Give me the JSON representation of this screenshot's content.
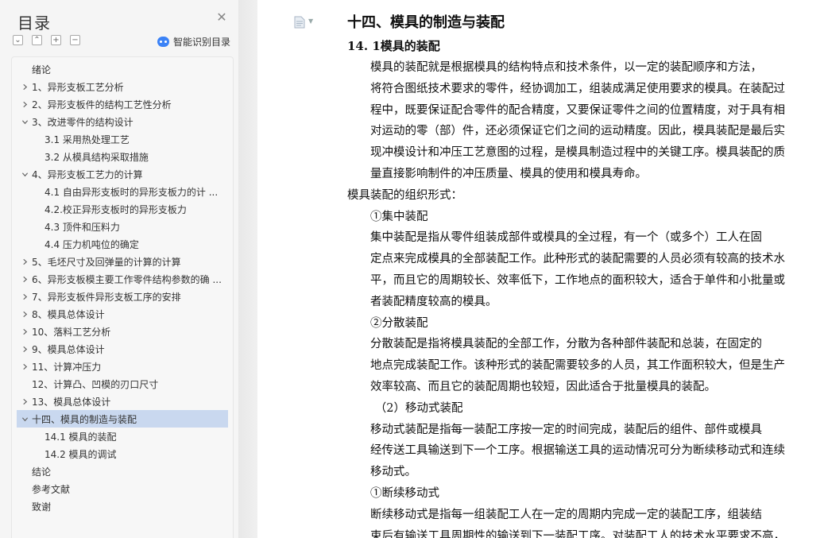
{
  "toc": {
    "title": "目录",
    "smart_label": "智能识别目录",
    "items": [
      {
        "label": "绪论",
        "level": 1,
        "expand": "none"
      },
      {
        "label": "1、异形支板工艺分析",
        "level": 1,
        "expand": "collapsed"
      },
      {
        "label": "2、异形支板件的结构工艺性分析",
        "level": 1,
        "expand": "collapsed"
      },
      {
        "label": "3、改进零件的结构设计",
        "level": 1,
        "expand": "expanded"
      },
      {
        "label": "3.1 采用热处理工艺",
        "level": 2,
        "expand": "none"
      },
      {
        "label": "3.2 从模具结构采取措施",
        "level": 2,
        "expand": "none"
      },
      {
        "label": "4、异形支板工艺力的计算",
        "level": 1,
        "expand": "expanded"
      },
      {
        "label": "4.1 自由异形支板时的异形支板力的计 ...",
        "level": 2,
        "expand": "none"
      },
      {
        "label": "4.2.校正异形支板时的异形支板力",
        "level": 2,
        "expand": "none"
      },
      {
        "label": "4.3 顶件和压料力",
        "level": 2,
        "expand": "none"
      },
      {
        "label": "4.4 压力机吨位的确定",
        "level": 2,
        "expand": "none"
      },
      {
        "label": "5、毛坯尺寸及回弹量的计算的计算",
        "level": 1,
        "expand": "collapsed"
      },
      {
        "label": "6、异形支板模主要工作零件结构参数的确 ...",
        "level": 1,
        "expand": "collapsed"
      },
      {
        "label": "7、异形支板件异形支板工序的安排",
        "level": 1,
        "expand": "collapsed"
      },
      {
        "label": "8、模具总体设计",
        "level": 1,
        "expand": "collapsed"
      },
      {
        "label": "10、落料工艺分析",
        "level": 1,
        "expand": "collapsed"
      },
      {
        "label": "9、模具总体设计",
        "level": 1,
        "expand": "collapsed"
      },
      {
        "label": "11、计算冲压力",
        "level": 1,
        "expand": "collapsed"
      },
      {
        "label": "12、计算凸、凹模的刃口尺寸",
        "level": 1,
        "expand": "none"
      },
      {
        "label": "13、模具总体设计",
        "level": 1,
        "expand": "collapsed"
      },
      {
        "label": "十四、模具的制造与装配",
        "level": 1,
        "expand": "expanded",
        "active": true
      },
      {
        "label": "14.1 模具的装配",
        "level": 2,
        "expand": "none"
      },
      {
        "label": "14.2  模具的调试",
        "level": 2,
        "expand": "none"
      },
      {
        "label": "结论",
        "level": 1,
        "expand": "none"
      },
      {
        "label": "参考文献",
        "level": 1,
        "expand": "none"
      },
      {
        "label": "致谢",
        "level": 1,
        "expand": "none"
      }
    ]
  },
  "doc": {
    "h1": "十四、模具的制造与装配",
    "h2": "14. 1模具的装配",
    "paragraphs": [
      {
        "indent": "indent",
        "lines": [
          "模具的装配就是根据模具的结构特点和技术条件，以一定的装配顺序和方法，",
          "将符合图纸技术要求的零件，经协调加工，组装成满足使用要求的模具。在装配过",
          "程中，既要保证配合零件的配合精度，又要保证零件之间的位置精度，对于具有相",
          "对运动的零（部）件，还必须保证它们之间的运动精度。因此，模具装配是最后实",
          "现冲模设计和冲压工艺意图的过程，是模具制造过程中的关键工序。模具装配的质",
          "量直接影响制件的冲压质量、模具的使用和模具寿命。"
        ]
      },
      {
        "indent": "none",
        "lines": [
          "模具装配的组织形式："
        ]
      },
      {
        "indent": "indent",
        "lines": [
          "①集中装配"
        ]
      },
      {
        "indent": "indent",
        "lines": [
          "集中装配是指从零件组装成部件或模具的全过程，有一个（或多个）工人在固",
          "定点来完成模具的全部装配工作。此种形式的装配需要的人员必须有较高的技术水",
          "平，而且它的周期较长、效率低下，工作地点的面积较大，适合于单件和小批量或",
          "者装配精度较高的模具。"
        ]
      },
      {
        "indent": "indent",
        "lines": [
          "②分散装配"
        ]
      },
      {
        "indent": "indent",
        "lines": [
          "分散装配是指将模具装配的全部工作，分散为各种部件装配和总装，在固定的",
          "地点完成装配工作。该种形式的装配需要较多的人员，其工作面积较大，但是生产",
          "效率较高、而且它的装配周期也较短，因此适合于批量模具的装配。"
        ]
      },
      {
        "indent": "indent15",
        "lines": [
          "（2）移动式装配"
        ]
      },
      {
        "indent": "indent",
        "lines": [
          "移动式装配是指每一装配工序按一定的时间完成，装配后的组件、部件或模具",
          "经传送工具输送到下一个工序。根据输送工具的运动情况可分为断续移动式和连续",
          "移动式。"
        ]
      },
      {
        "indent": "indent",
        "lines": [
          "①断续移动式"
        ]
      },
      {
        "indent": "indent",
        "lines": [
          "断续移动式是指每一组装配工人在一定的周期内完成一定的装配工序，组装结",
          "束后有输送工具周期性的输送到下一装配工序。对装配工人的技术水平要求不高，"
        ]
      }
    ]
  }
}
